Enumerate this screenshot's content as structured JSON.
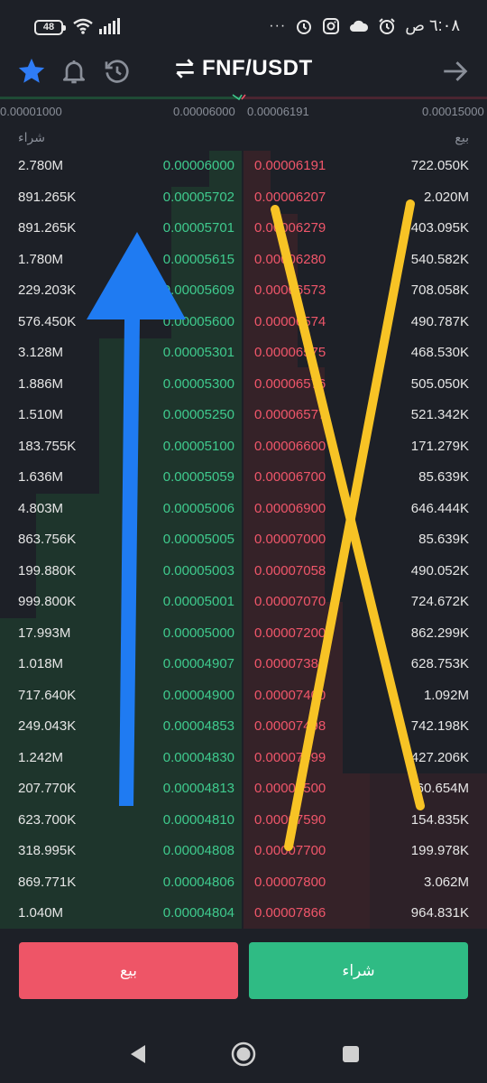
{
  "status_bar": {
    "battery": "48",
    "time": "٦:٠٨ ص",
    "more": "···"
  },
  "header": {
    "pair": "FNF/USDT",
    "icons": [
      "star-icon",
      "bell-icon",
      "history-icon",
      "swap-icon",
      "arrow-right-icon"
    ],
    "accent_color": "#2f7cf6"
  },
  "axis": {
    "tick1": "0.00001000",
    "tick2": "0.00006000",
    "tick3": "0.00006191",
    "tick4": "0.00015000"
  },
  "columns": {
    "buy_label": "شراء",
    "sell_label": "بيع"
  },
  "rows": [
    {
      "bq": "2.780M",
      "bp": "0.00006000",
      "ap": "0.00006191",
      "aq": "722.050K"
    },
    {
      "bq": "891.265K",
      "bp": "0.00005702",
      "ap": "0.00006207",
      "aq": "2.020M"
    },
    {
      "bq": "891.265K",
      "bp": "0.00005701",
      "ap": "0.00006279",
      "aq": "403.095K"
    },
    {
      "bq": "1.780M",
      "bp": "0.00005615",
      "ap": "0.00006280",
      "aq": "540.582K"
    },
    {
      "bq": "229.203K",
      "bp": "0.00005609",
      "ap": "0.00006573",
      "aq": "708.058K"
    },
    {
      "bq": "576.450K",
      "bp": "0.00005600",
      "ap": "0.00006574",
      "aq": "490.787K"
    },
    {
      "bq": "3.128M",
      "bp": "0.00005301",
      "ap": "0.00006575",
      "aq": "468.530K"
    },
    {
      "bq": "1.886M",
      "bp": "0.00005300",
      "ap": "0.00006576",
      "aq": "505.050K"
    },
    {
      "bq": "1.510M",
      "bp": "0.00005250",
      "ap": "0.00006577",
      "aq": "521.342K"
    },
    {
      "bq": "183.755K",
      "bp": "0.00005100",
      "ap": "0.00006600",
      "aq": "171.279K"
    },
    {
      "bq": "1.636M",
      "bp": "0.00005059",
      "ap": "0.00006700",
      "aq": "85.639K"
    },
    {
      "bq": "4.803M",
      "bp": "0.00005006",
      "ap": "0.00006900",
      "aq": "646.444K"
    },
    {
      "bq": "863.756K",
      "bp": "0.00005005",
      "ap": "0.00007000",
      "aq": "85.639K"
    },
    {
      "bq": "199.880K",
      "bp": "0.00005003",
      "ap": "0.00007058",
      "aq": "490.052K"
    },
    {
      "bq": "999.800K",
      "bp": "0.00005001",
      "ap": "0.00007070",
      "aq": "724.672K"
    },
    {
      "bq": "17.993M",
      "bp": "0.00005000",
      "ap": "0.00007200",
      "aq": "862.299K"
    },
    {
      "bq": "1.018M",
      "bp": "0.00004907",
      "ap": "0.00007385",
      "aq": "628.753K"
    },
    {
      "bq": "717.640K",
      "bp": "0.00004900",
      "ap": "0.00007400",
      "aq": "1.092M"
    },
    {
      "bq": "249.043K",
      "bp": "0.00004853",
      "ap": "0.00007498",
      "aq": "742.198K"
    },
    {
      "bq": "1.242M",
      "bp": "0.00004830",
      "ap": "0.00007499",
      "aq": "427.206K"
    },
    {
      "bq": "207.770K",
      "bp": "0.00004813",
      "ap": "0.00007500",
      "aq": "60.654M"
    },
    {
      "bq": "623.700K",
      "bp": "0.00004810",
      "ap": "0.00007590",
      "aq": "154.835K"
    },
    {
      "bq": "318.995K",
      "bp": "0.00004808",
      "ap": "0.00007700",
      "aq": "199.978K"
    },
    {
      "bq": "869.771K",
      "bp": "0.00004806",
      "ap": "0.00007800",
      "aq": "3.062M"
    },
    {
      "bq": "1.040M",
      "bp": "0.00004804",
      "ap": "0.00007866",
      "aq": "964.831K"
    }
  ],
  "actions": {
    "sell_button": "بيع",
    "buy_button": "شراء"
  },
  "colors": {
    "buy": "#3fcb8e",
    "sell": "#f0566a",
    "sell_button": "#ee5567",
    "buy_button": "#2fbb84",
    "annotation_arrow": "#1f7bf2",
    "annotation_cross": "#f7c325"
  },
  "annotations": {
    "arrow": "blue-up-arrow",
    "cross": "yellow-x-mark"
  }
}
